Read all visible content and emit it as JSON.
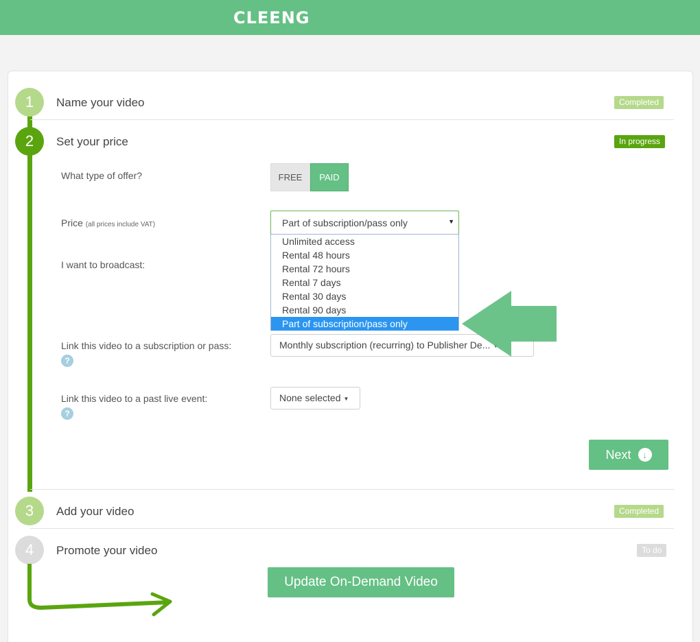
{
  "brand": {
    "logo_text": "CLEENG",
    "color": "#64c084"
  },
  "steps": [
    {
      "number": "1",
      "title": "Name your video",
      "badge": "Completed",
      "state": "completed"
    },
    {
      "number": "2",
      "title": "Set your price",
      "badge": "In progress",
      "state": "in-progress"
    },
    {
      "number": "3",
      "title": "Add your video",
      "badge": "Completed",
      "state": "completed"
    },
    {
      "number": "4",
      "title": "Promote your video",
      "badge": "To do",
      "state": "todo"
    }
  ],
  "form": {
    "offer_type_label": "What type of offer?",
    "offer_free": "FREE",
    "offer_paid": "PAID",
    "price_label": "Price",
    "price_note": "(all prices include VAT)",
    "price_selected": "Part of subscription/pass only",
    "price_options": [
      "Unlimited access",
      "Rental 48 hours",
      "Rental 72 hours",
      "Rental 7 days",
      "Rental 30 days",
      "Rental 90 days",
      "Part of subscription/pass only"
    ],
    "broadcast_label": "I want to broadcast:",
    "subscription_label": "Link this video to a subscription or pass:",
    "subscription_value": "Monthly subscription (recurring) to Publisher De...",
    "live_event_label": "Link this video to a past live event:",
    "live_event_value": "None selected",
    "help_glyph": "?"
  },
  "buttons": {
    "next": "Next",
    "update": "Update On-Demand Video"
  },
  "colors": {
    "accent_green": "#5aa50f",
    "light_green": "#b5d98a",
    "selected_blue": "#2b95f0"
  }
}
